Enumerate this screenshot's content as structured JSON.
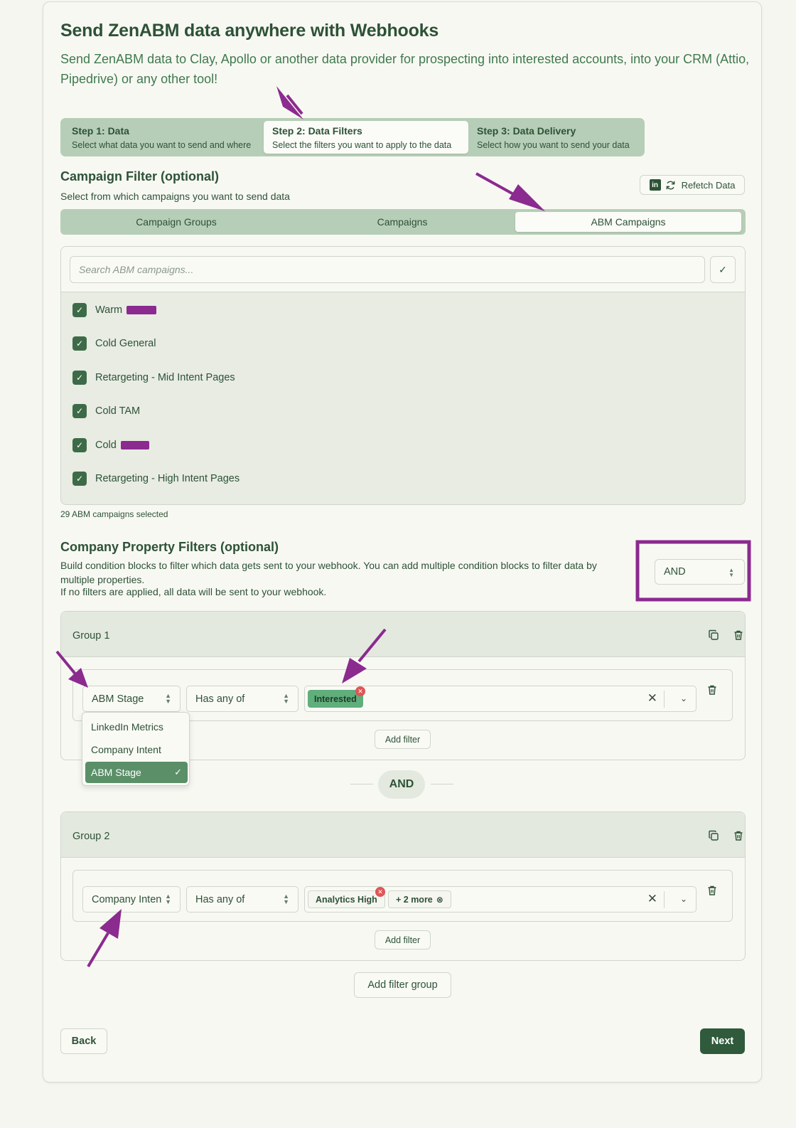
{
  "header": {
    "title": "Send ZenABM data anywhere with Webhooks",
    "subtitle": "Send ZenABM data to Clay, Apollo or another data provider for prospecting into interested accounts, into your CRM (Attio, Pipedrive) or any other tool!"
  },
  "steps": [
    {
      "title": "Step 1: Data",
      "desc": "Select what data you want to send and where"
    },
    {
      "title": "Step 2: Data Filters",
      "desc": "Select the filters you want to apply to the data"
    },
    {
      "title": "Step 3: Data Delivery",
      "desc": "Select how you want to send your data"
    }
  ],
  "campaign_filter": {
    "title": "Campaign Filter (optional)",
    "desc": "Select from which campaigns you want to send data",
    "refetch_label": "Refetch Data",
    "tabs": [
      "Campaign Groups",
      "Campaigns",
      "ABM Campaigns"
    ],
    "active_tab": "ABM Campaigns",
    "search_placeholder": "Search ABM campaigns...",
    "items": [
      {
        "label": "Warm",
        "checked": true
      },
      {
        "label": "Cold General",
        "checked": true
      },
      {
        "label": "Retargeting - Mid Intent Pages",
        "checked": true
      },
      {
        "label": "Cold TAM",
        "checked": true
      },
      {
        "label": "Cold",
        "checked": true
      },
      {
        "label": "Retargeting - High Intent Pages",
        "checked": true
      }
    ],
    "selected_count": "29 ABM campaigns selected"
  },
  "property_filters": {
    "title": "Company Property Filters (optional)",
    "desc1": "Build condition blocks to filter which data gets sent to your webhook. You can add multiple condition blocks to filter data by multiple properties.",
    "desc2": "If no filters are applied, all data will be sent to your webhook.",
    "combinator": "AND",
    "add_filter_label": "Add filter",
    "add_group_label": "Add filter group",
    "groups": [
      {
        "title": "Group 1",
        "property": "ABM Stage",
        "operator": "Has any of",
        "chips": [
          "Interested"
        ]
      },
      {
        "title": "Group 2",
        "property": "Company Intent",
        "operator": "Has any of",
        "chips": [
          "Analytics High"
        ],
        "more": "+ 2 more"
      }
    ],
    "property_options": [
      "LinkedIn Metrics",
      "Company Intent",
      "ABM Stage"
    ],
    "selected_property": "ABM Stage",
    "group_separator": "AND"
  },
  "footer": {
    "back_label": "Back",
    "next_label": "Next"
  },
  "colors": {
    "primary": "#2f5a3b",
    "accent_bg": "#b6ceb7",
    "chip_green": "#5fae7c",
    "annotation": "#8b2a8f"
  }
}
